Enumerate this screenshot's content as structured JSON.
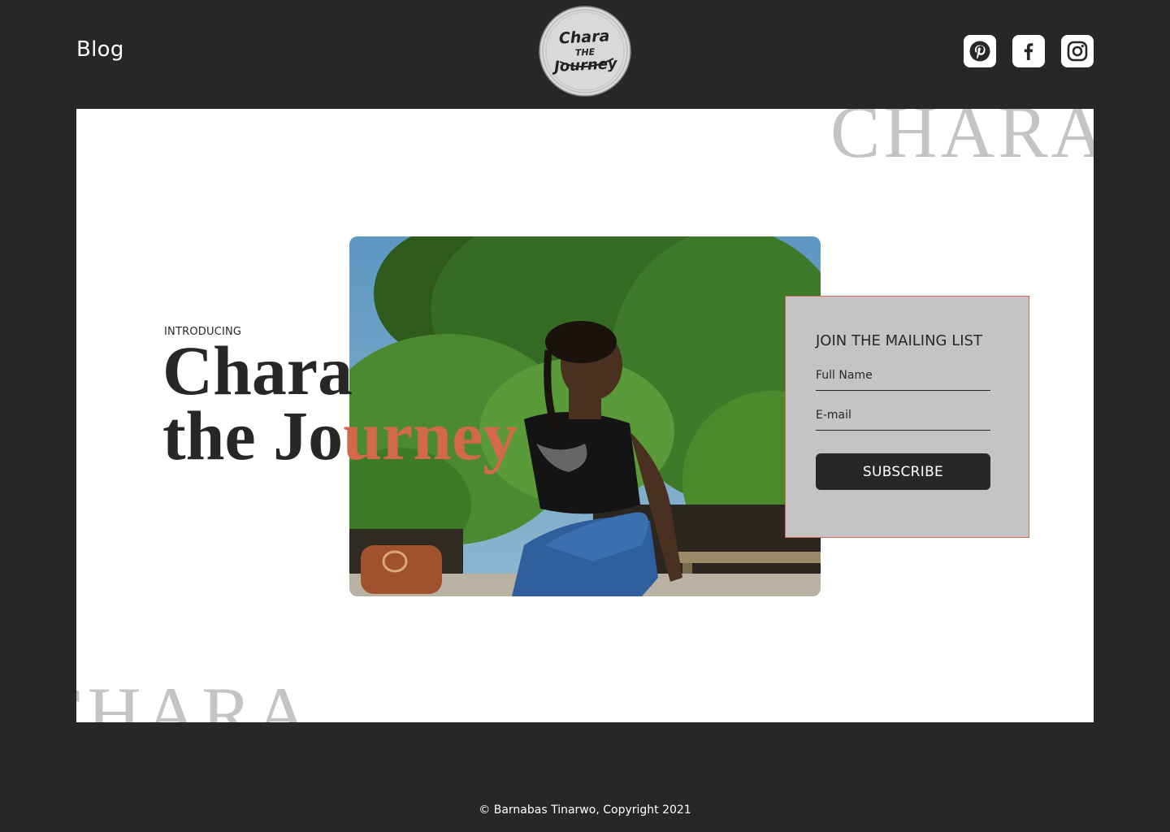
{
  "header": {
    "nav_blog": "Blog",
    "logo": {
      "line1": "Chara",
      "line2": "THE",
      "line3": "Journey"
    },
    "socials": [
      {
        "name": "pinterest-icon"
      },
      {
        "name": "facebook-icon"
      },
      {
        "name": "instagram-icon"
      }
    ]
  },
  "hero": {
    "watermark_top": "CHARA",
    "watermark_bottom": "CHARA",
    "intro": "INTRODUCING",
    "title_line1": "Chara",
    "title_line2_prefix": "the Jo",
    "title_line2_accent": "urney",
    "photo_alt": "Woman in jeans sitting outdoors in front of green trees"
  },
  "mailing": {
    "heading": "JOIN THE MAILING LIST",
    "name_placeholder": "Full Name",
    "email_placeholder": "E-mail",
    "button": "SUBSCRIBE"
  },
  "footer": {
    "copyright": "© Barnabas Tinarwo, Copyright 2021"
  },
  "colors": {
    "background": "#272727",
    "accent": "#d2694a",
    "panel": "#c4c4c4",
    "white": "#ffffff"
  }
}
